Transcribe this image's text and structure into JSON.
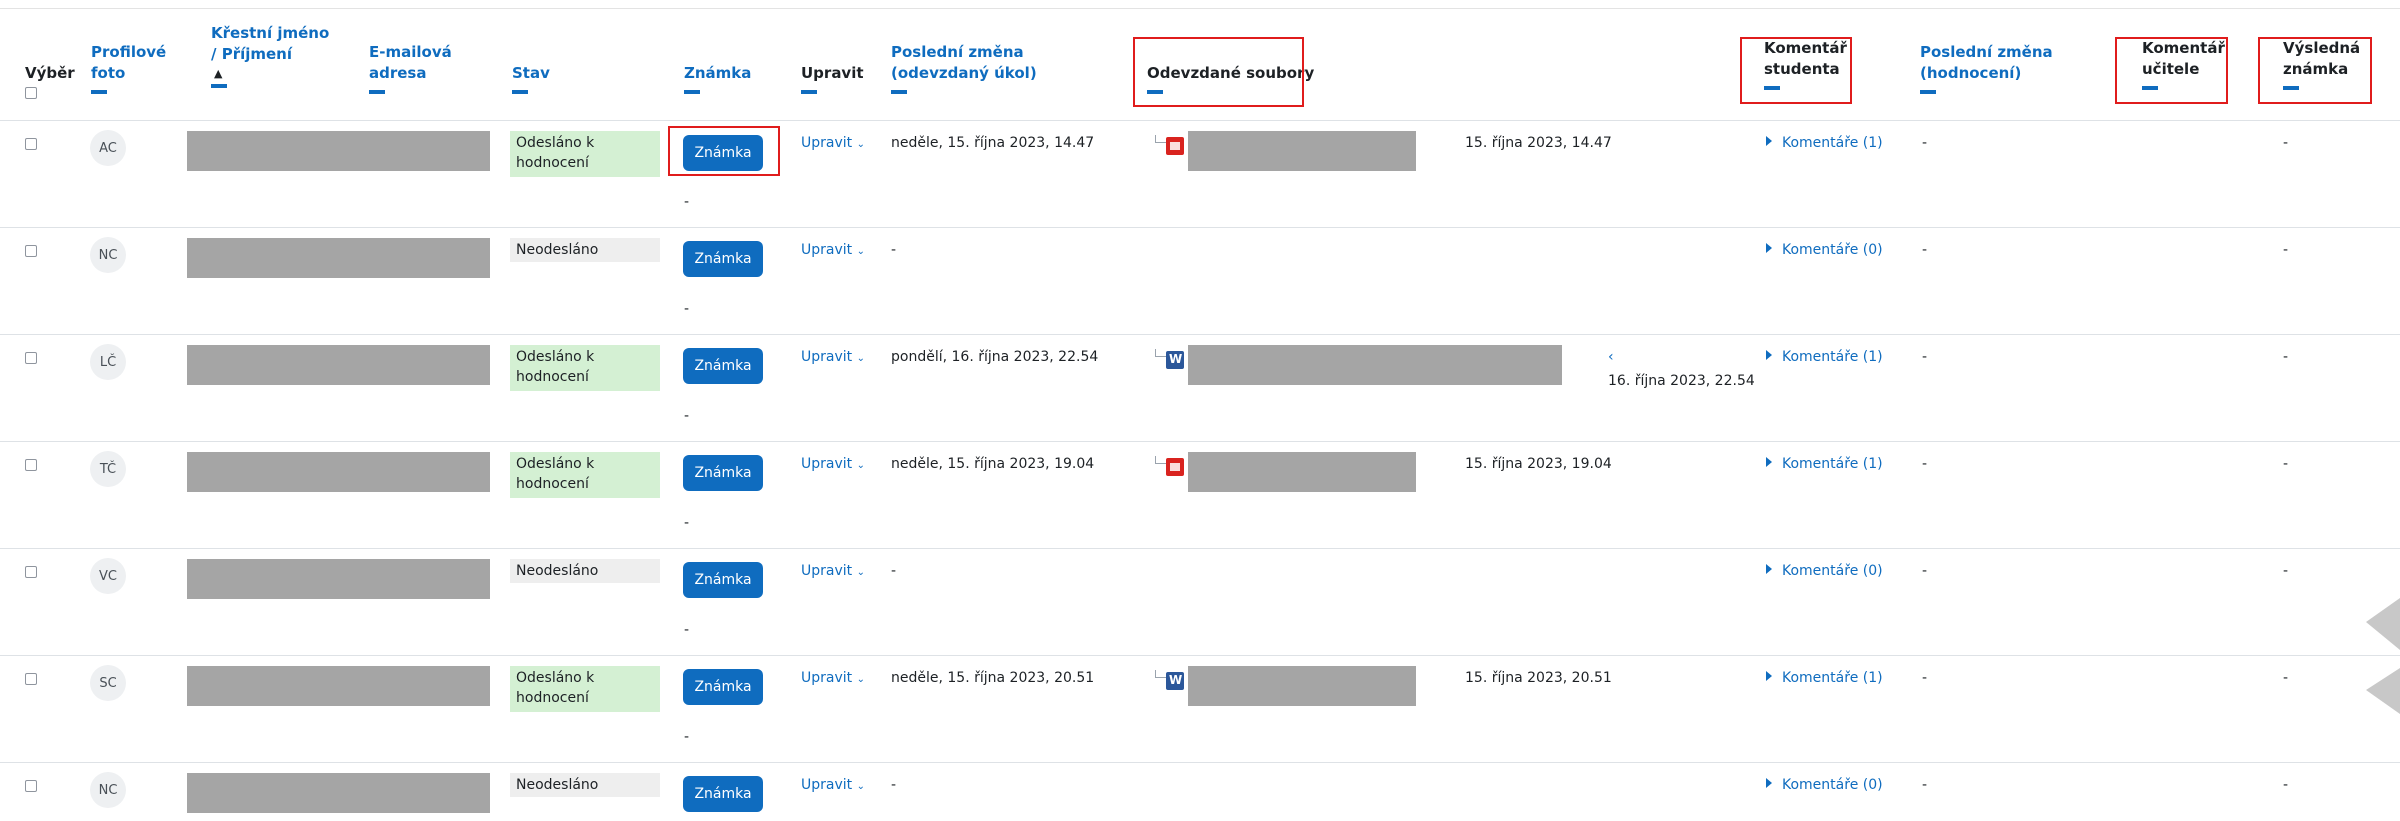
{
  "headers": {
    "select": "Výběr",
    "photo": "Profilové foto",
    "name_first": "Křestní jméno",
    "name_last": "/ Příjmení",
    "email": "E-mailová adresa",
    "status": "Stav",
    "grade": "Známka",
    "edit": "Upravit",
    "modified_submission": "Poslední změna (odevzdaný úkol)",
    "files": "Odevzdané soubory",
    "student_comment": "Komentář studenta",
    "modified_grading": "Poslední změna (hodnocení)",
    "teacher_comment": "Komentář učitele",
    "final_grade": "Výsledná známka"
  },
  "rows": [
    {
      "initials": "AC",
      "status": "Odesláno k hodnocení",
      "status_kind": "sent",
      "grade_button": "Známka",
      "grade_value": "-",
      "edit": "Upravit",
      "modified": "neděle, 15. října 2023, 14.47",
      "file_icon": "pdf-icon",
      "file_date": "15. října 2023, 14.47",
      "comments": "Komentáře (1)",
      "grading_modified": "-",
      "final": "-"
    },
    {
      "initials": "NC",
      "status": "Neodesláno",
      "status_kind": "notsent",
      "grade_button": "Známka",
      "grade_value": "-",
      "edit": "Upravit",
      "modified": "-",
      "file_icon": "",
      "file_date": "",
      "comments": "Komentáře (0)",
      "grading_modified": "-",
      "final": "-"
    },
    {
      "initials": "LČ",
      "status": "Odesláno k hodnocení",
      "status_kind": "sent",
      "grade_button": "Známka",
      "grade_value": "-",
      "edit": "Upravit",
      "modified": "pondělí, 16. října 2023, 22.54",
      "file_icon": "word-icon",
      "file_prefix": "‹",
      "file_date": "16. října 2023, 22.54",
      "comments": "Komentáře (1)",
      "grading_modified": "-",
      "final": "-"
    },
    {
      "initials": "TČ",
      "status": "Odesláno k hodnocení",
      "status_kind": "sent",
      "grade_button": "Známka",
      "grade_value": "-",
      "edit": "Upravit",
      "modified": "neděle, 15. října 2023, 19.04",
      "file_icon": "pdf-icon",
      "file_date": "15. října 2023, 19.04",
      "comments": "Komentáře (1)",
      "grading_modified": "-",
      "final": "-"
    },
    {
      "initials": "VC",
      "status": "Neodesláno",
      "status_kind": "notsent",
      "grade_button": "Známka",
      "grade_value": "-",
      "edit": "Upravit",
      "modified": "-",
      "file_icon": "",
      "file_date": "",
      "comments": "Komentáře (0)",
      "grading_modified": "-",
      "final": "-"
    },
    {
      "initials": "SC",
      "status": "Odesláno k hodnocení",
      "status_kind": "sent",
      "grade_button": "Známka",
      "grade_value": "-",
      "edit": "Upravit",
      "modified": "neděle, 15. října 2023, 20.51",
      "file_icon": "word-icon",
      "file_date": "15. října 2023, 20.51",
      "comments": "Komentáře (1)",
      "grading_modified": "-",
      "final": "-"
    },
    {
      "initials": "NC",
      "status": "Neodesláno",
      "status_kind": "notsent",
      "grade_button": "Známka",
      "grade_value": "",
      "edit": "Upravit",
      "modified": "-",
      "file_icon": "",
      "file_date": "",
      "comments": "Komentáře (0)",
      "grading_modified": "-",
      "final": "-"
    }
  ],
  "colors": {
    "accent": "#0f6cbf",
    "highlight_box": "#e01c1c",
    "sent_bg": "#d4f0d3",
    "notsent_bg": "#eeeeee",
    "redaction": "#a5a5a5"
  }
}
